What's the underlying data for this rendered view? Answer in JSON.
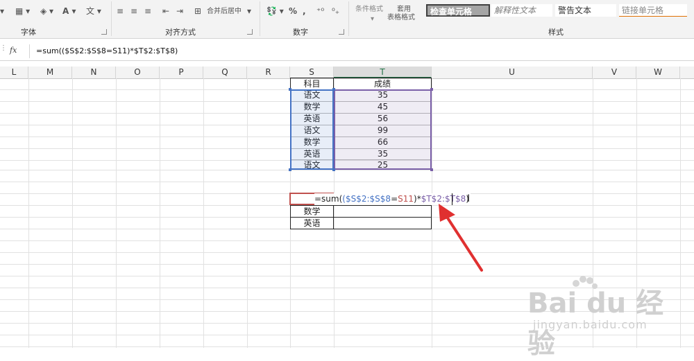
{
  "ribbon": {
    "groups": {
      "font": "字体",
      "alignment": "对齐方式",
      "number": "数字",
      "styles": "样式"
    },
    "merge_center": "合并后居中",
    "conditional_format": "条件格式",
    "table_format_1": "套用",
    "table_format_2": "表格格式",
    "style_check_cell": "检查单元格",
    "style_explanatory": "解释性文本",
    "style_warning": "警告文本",
    "style_linked": "链接单元格",
    "percent": "%",
    "comma": ","
  },
  "formula_bar": {
    "fx": "fx",
    "formula": "=sum(($S$2:$S$8=S11)*$T$2:$T$8)"
  },
  "columns": [
    "L",
    "M",
    "N",
    "O",
    "P",
    "Q",
    "R",
    "S",
    "T",
    "U",
    "V",
    "W"
  ],
  "table": {
    "header_subject": "科目",
    "header_score": "成绩",
    "rows": [
      {
        "subject": "语文",
        "score": "35"
      },
      {
        "subject": "数学",
        "score": "45"
      },
      {
        "subject": "英语",
        "score": "56"
      },
      {
        "subject": "语文",
        "score": "99"
      },
      {
        "subject": "数学",
        "score": "66"
      },
      {
        "subject": "英语",
        "score": "35"
      },
      {
        "subject": "语文",
        "score": "25"
      }
    ]
  },
  "summary": {
    "edit_prefix": "=sum(",
    "edit_s_range": "($S$2:$S$8",
    "edit_eq": "=",
    "edit_crit": "S11",
    "edit_close_mul": ")*",
    "edit_t_range": "$T$2:$T$8",
    "edit_close": ")",
    "row2": "数学",
    "row3": "英语"
  },
  "watermark": {
    "brand": "Bai du 经验",
    "url": "jingyan.baidu.com"
  },
  "colors": {
    "accent_green": "#217346",
    "s_range": "#4472c4",
    "t_range": "#7a5fa8",
    "criterion": "#c0504d",
    "arrow": "#e03030"
  }
}
